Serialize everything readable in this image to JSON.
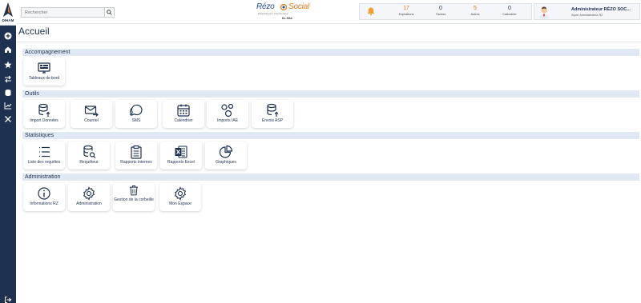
{
  "app": {
    "rail_logo_text": "DIHAM",
    "brand_part1": "Rézo",
    "brand_part2": "Social",
    "brand_tagline": "Essentiel pour l'interlocuteur",
    "brand_version": "DL.SSA"
  },
  "search": {
    "placeholder": "Rechercher"
  },
  "stats": [
    {
      "value": "17",
      "label": "Expirations",
      "color": "#e07a20"
    },
    {
      "value": "0",
      "label": "Tâches",
      "color": "#1f3150"
    },
    {
      "value": "5",
      "label": "Autres",
      "color": "#e07a20"
    },
    {
      "value": "0",
      "label": "Calendrier",
      "color": "#1f3150"
    }
  ],
  "user": {
    "name": "Administrateur RÉZO SOC...",
    "role": "Super Administrateur RZ"
  },
  "page": {
    "title": "Accueil"
  },
  "sections": {
    "accompagnement": {
      "label": "Accompagnement",
      "tiles": [
        {
          "label": "Tableaux de bord",
          "icon": "dashboard-icon"
        }
      ]
    },
    "outils": {
      "label": "Outils",
      "tiles": [
        {
          "label": "Import Données",
          "icon": "database-upload-icon"
        },
        {
          "label": "Courriel",
          "icon": "mail-send-icon"
        },
        {
          "label": "SMS",
          "icon": "sms-chat-icon"
        },
        {
          "label": "Calendrier",
          "icon": "calendar-icon"
        },
        {
          "label": "Imports IAE",
          "icon": "circles-icon"
        },
        {
          "label": "Envois ASP",
          "icon": "database-send-icon"
        }
      ]
    },
    "statistiques": {
      "label": "Statistiques",
      "tiles": [
        {
          "label": "Liste des requêtes",
          "icon": "list-icon"
        },
        {
          "label": "Requêteur",
          "icon": "database-search-icon"
        },
        {
          "label": "Rapports internes",
          "icon": "clipboard-icon"
        },
        {
          "label": "Rapports Excel",
          "icon": "excel-icon"
        },
        {
          "label": "Graphiques",
          "icon": "pie-chart-icon"
        }
      ]
    },
    "administration": {
      "label": "Administration",
      "tiles": [
        {
          "label": "Informations RZ",
          "icon": "info-icon"
        },
        {
          "label": "Administration",
          "icon": "settings-icon"
        },
        {
          "label": "Gestion de la corbeille",
          "icon": "trash-icon"
        },
        {
          "label": "Mon Espace",
          "icon": "settings-icon"
        }
      ]
    }
  },
  "colors": {
    "navy": "#1f3150",
    "accent_orange": "#e07a20",
    "section_bg": "#dfe8f3",
    "excel_green": "#1f3150"
  }
}
